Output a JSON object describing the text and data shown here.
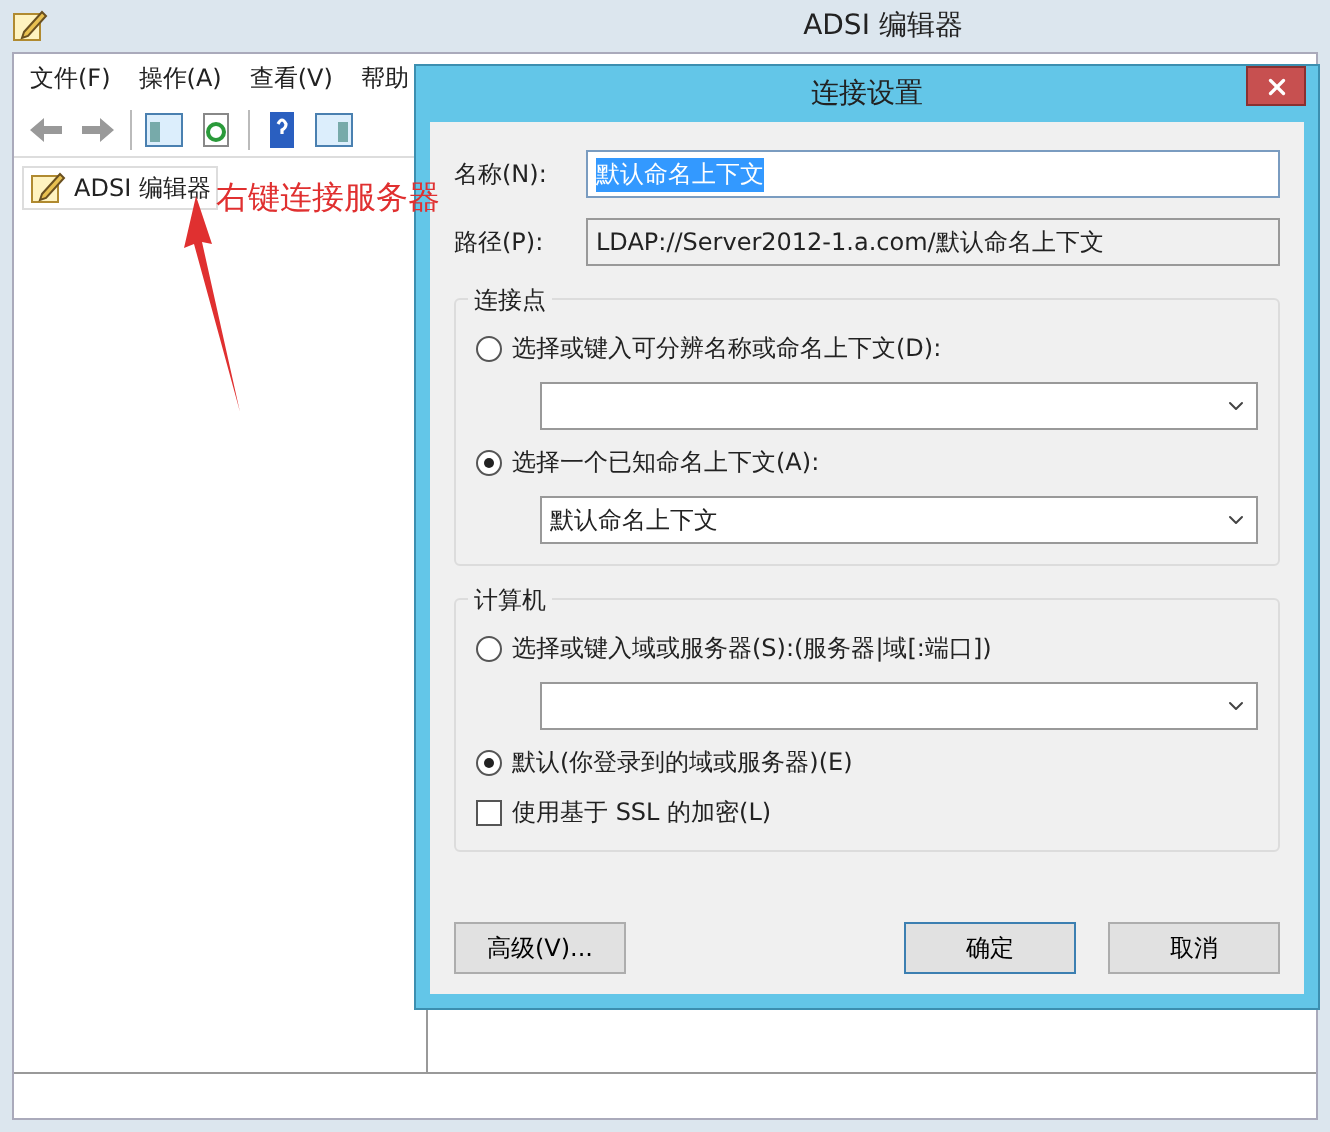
{
  "window": {
    "title": "ADSI 编辑器"
  },
  "menu": [
    "文件(F)",
    "操作(A)",
    "查看(V)",
    "帮助"
  ],
  "tree": {
    "items": [
      {
        "label": "ADSI 编辑器"
      }
    ]
  },
  "annotation": {
    "text": "右键连接服务器"
  },
  "dialog": {
    "title": "连接设置",
    "name": {
      "label": "名称(N):",
      "value": "默认命名上下文",
      "highlighted": true
    },
    "path": {
      "label": "路径(P):",
      "value": "LDAP://Server2012-1.a.com/默认命名上下文"
    },
    "connection_point": {
      "title": "连接点",
      "options": [
        {
          "label": "选择或键入可分辨名称或命名上下文(D):",
          "selected": false,
          "kind": "combo"
        },
        {
          "label": "选择一个已知命名上下文(A):",
          "selected": true,
          "kind": "combo",
          "value": "默认命名上下文"
        }
      ]
    },
    "computer": {
      "title": "计算机",
      "options": [
        {
          "label": "选择或键入域或服务器(S):(服务器|域[:端口])",
          "selected": false,
          "kind": "combo"
        },
        {
          "label": "默认(你登录到的域或服务器)(E)",
          "selected": true,
          "kind": "plain"
        }
      ]
    },
    "ssl": {
      "label": "使用基于 SSL 的加密(L)",
      "checked": false
    },
    "buttons": [
      {
        "label": "高级(V)...",
        "kind": "left"
      },
      {
        "label": "确定",
        "kind": "default"
      },
      {
        "label": "取消",
        "kind": "normal"
      }
    ]
  }
}
